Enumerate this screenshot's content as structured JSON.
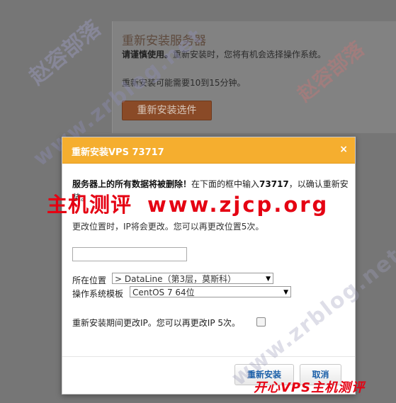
{
  "background": {
    "title": "重新安装服务器",
    "caution": "请谨慎使用。",
    "caution_rest": "重新安装时，您将有机会选择操作系统。",
    "duration": "重新安装可能需要10到15分钟。",
    "reinstall_button": "重新安装选件"
  },
  "modal": {
    "title": "重新安装VPS 73717",
    "close": "×",
    "warning_bold": "服务器上的所有数据将被删除！",
    "warning_rest": "在下面的框中输入",
    "warning_id": "73717",
    "warning_end": "，以确认重新安装。",
    "location_note": "更改位置时，IP将会更改。您可以再更改位置5次。",
    "confirm_input_value": "",
    "location_label": "所在位置",
    "location_value": "> DataLine（第3层，莫斯科）",
    "os_label": "操作系统模板",
    "os_value": "CentOS 7 64位",
    "ip_change_label": "重新安装期间更改IP。您可以再更改IP 5次。",
    "ip_change_checked": false,
    "submit_button": "重新安装",
    "cancel_button": "取消"
  },
  "overlay": {
    "promo_name": "主机测评",
    "promo_url": "www.zjcp.org",
    "signature": "开心VPS主机测评",
    "watermark_logo": "赵容部落",
    "watermark_url": "www.zrblog.net"
  },
  "colors": {
    "header": "#f5ae2f",
    "promo": "#e50012",
    "bg_button": "#8a4a27"
  }
}
